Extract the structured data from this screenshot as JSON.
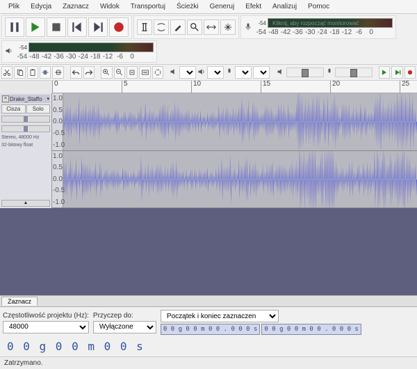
{
  "menu": {
    "file": "Plik",
    "edit": "Edycja",
    "select": "Zaznacz",
    "view": "Widok",
    "transport": "Transportuj",
    "tracks": "Ścieżki",
    "generate": "Generuj",
    "effect": "Efekt",
    "analyze": "Analizuj",
    "help": "Pomoc"
  },
  "meters": {
    "rec_hint": "Kliknij, aby rozpocząć monitorować",
    "scale": [
      "-54",
      "-48",
      "-42",
      "-36",
      "-30",
      "-24",
      "-18",
      "-12",
      "-6",
      "0"
    ],
    "rec_peak": "-54",
    "play_peak": "-54"
  },
  "timeline": {
    "marks": [
      "0",
      "5",
      "10",
      "15",
      "20",
      "25"
    ]
  },
  "track": {
    "name": "Drake_Staffo",
    "mute": "Cisza",
    "solo": "Solo",
    "rate": "Stereo, 48000 Hz",
    "format": "32-bitowy float",
    "ruler": [
      "1.0",
      "0.5",
      "0.0",
      "-0.5",
      "-1.0"
    ],
    "collapse": "▲"
  },
  "tabs": {
    "select": "Zaznacz"
  },
  "selection": {
    "rate_label": "Częstotliwość projektu (Hz):",
    "rate_value": "48000",
    "snap_label": "Przyczep do:",
    "snap_value": "Wyłączone",
    "position_label": "Początek i koniec zaznaczenia",
    "t1": "0 0 g 0 0 m 0 0 . 0 0 0 s",
    "t2": "0 0 g 0 0 m 0 0 . 0 0 0 s",
    "big": "0 0 g 0 0 m 0 0 s"
  },
  "status": {
    "text": "Zatrzymano."
  }
}
